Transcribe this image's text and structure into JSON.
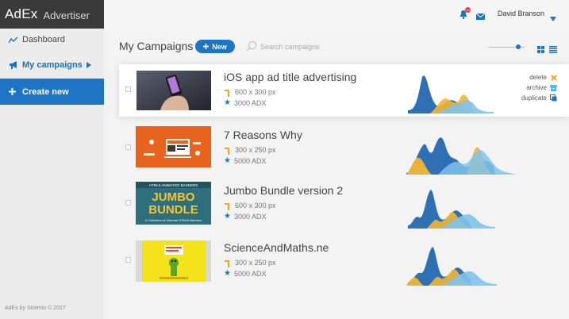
{
  "app": {
    "logo": "AdEx",
    "subtitle": "Advertiser",
    "footer": "AdEx by Stremio © 2017"
  },
  "sidebar": {
    "items": [
      {
        "label": "Dashboard",
        "icon": "chart-line-icon"
      },
      {
        "label": "My campaigns",
        "icon": "megaphone-icon",
        "active": true
      },
      {
        "label": "Create new",
        "icon": "plus-icon"
      }
    ]
  },
  "topbar": {
    "notification_count": "10",
    "user_name": "David Branson"
  },
  "toolbar": {
    "title": "My Campaigns",
    "new_label": "New",
    "search_placeholder": "Search campaigns",
    "zoom_level": 0.82
  },
  "campaigns": [
    {
      "title": "iOS app ad title advertising",
      "dimensions": "600 x 300 px",
      "cost": "3000 ADX",
      "active": true,
      "thumbnail": "phone-in-hand-image",
      "actions": [
        {
          "label": "delete",
          "icon": "delete-icon"
        },
        {
          "label": "archive",
          "icon": "archive-icon"
        },
        {
          "label": "duplicate",
          "icon": "duplicate-icon"
        }
      ]
    },
    {
      "title": "7 Reasons Why",
      "dimensions": "300 x 250 px",
      "cost": "5000 ADX",
      "thumbnail": "orange-web-illustration"
    },
    {
      "title": "Jumbo Bundle version 2",
      "dimensions": "600 x 300 px",
      "cost": "3000 ADX",
      "thumbnail": "jumbo-bundle-banner",
      "thumb_text": {
        "top": "HTML5 ANIMATED BANNERS",
        "line1": "JUMBO",
        "line2": "BUNDLE",
        "bottom": "A Collection of Ultimate HTML5 Banners"
      }
    },
    {
      "title": "ScienceAndMaths.ne",
      "dimensions": "300 x 250 px",
      "cost": "5000 ADX",
      "thumbnail": "yellow-cartoon-banner"
    }
  ],
  "colors": {
    "accent": "#1e75c3",
    "sidebar_dark": "#3a3a3a",
    "chart_blue": "#2f6fb3",
    "chart_light_blue": "#7fc3ec",
    "chart_yellow": "#f2b534"
  }
}
